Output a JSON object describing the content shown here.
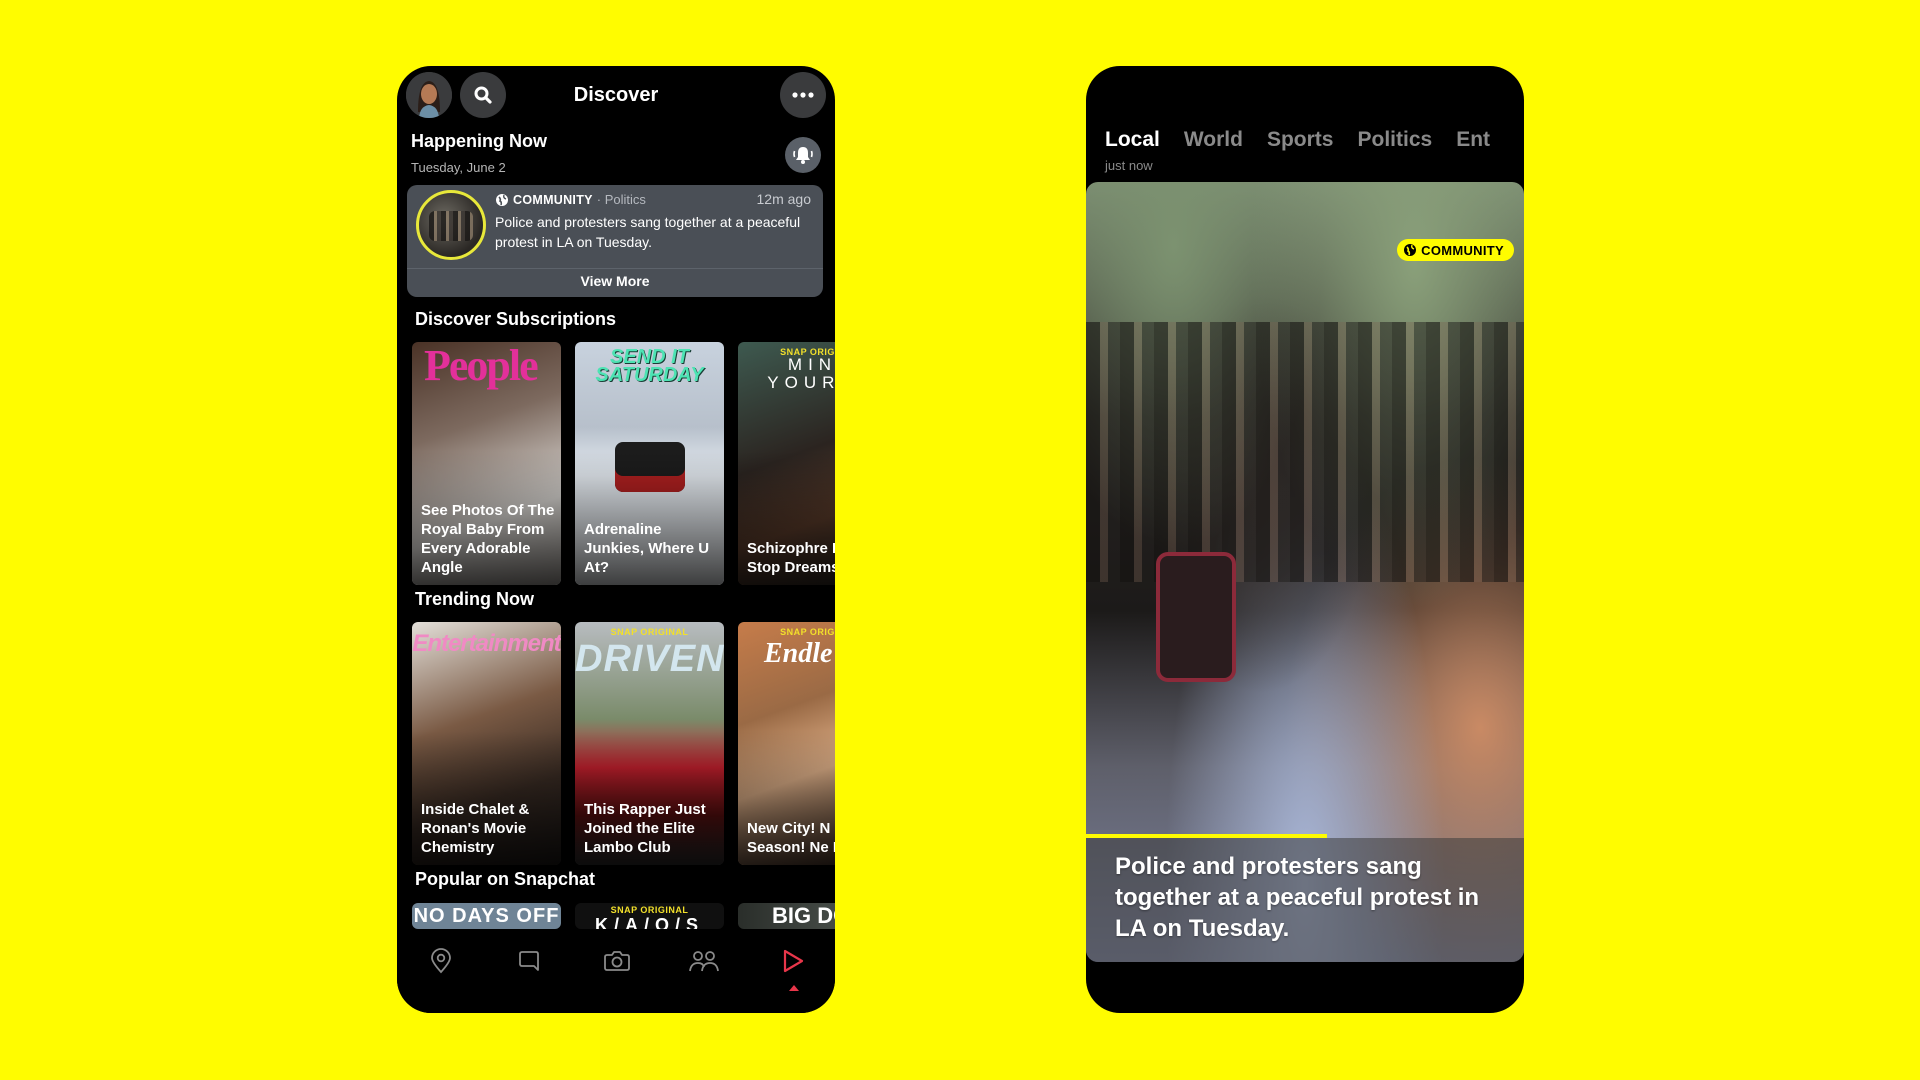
{
  "theme": {
    "background": "#FFFC00",
    "accent": "#FFFC00",
    "active_nav": "#E8364A",
    "card_bg": "#4A4F56"
  },
  "left_phone": {
    "header": {
      "avatar_icon": "bitmoji-avatar",
      "search_icon": "search-icon",
      "title": "Discover",
      "more_icon": "more-dots-icon"
    },
    "happening_now": {
      "title": "Happening Now",
      "date": "Tuesday, June 2",
      "notify_icon": "bell-ringing-icon",
      "story": {
        "source": "COMMUNITY",
        "category": "· Politics",
        "time": "12m ago",
        "headline": "Police and protesters sang together at a peaceful protest in LA on Tuesday.",
        "action": "View More"
      }
    },
    "sections": [
      {
        "title": "Discover Subscriptions",
        "tiles": [
          {
            "brand": "People",
            "snap_original": "",
            "caption": "See Photos Of The Royal Baby From Every Adorable Angle"
          },
          {
            "brand": "SEND IT SATURDAY",
            "snap_original": "",
            "caption": "Adrenaline Junkies, Where U At?"
          },
          {
            "brand": "MIN YOURS",
            "snap_original": "SNAP ORIGIN",
            "caption": "Schizophre Didn't Stop Dreams"
          }
        ]
      },
      {
        "title": "Trending Now",
        "tiles": [
          {
            "brand": "Entertainment",
            "snap_original": "",
            "caption": "Inside Chalet & Ronan's Movie Chemistry"
          },
          {
            "brand": "DRIVEN",
            "snap_original": "SNAP ORIGINAL",
            "caption": "This Rapper Just Joined the Elite Lambo Club"
          },
          {
            "brand": "Endle",
            "snap_original": "SNAP ORIGIN",
            "caption": "New City! N Season! Ne Dylan!"
          }
        ]
      },
      {
        "title": "Popular on Snapchat",
        "tiles": [
          {
            "brand": "NO DAYS OFF",
            "snap_original": ""
          },
          {
            "brand": "K/A/O/S",
            "snap_original": "SNAP ORIGINAL"
          },
          {
            "brand": "BIG DO",
            "snap_original": ""
          }
        ]
      }
    ],
    "bottom_nav": [
      {
        "name": "map",
        "icon": "map-pin-icon",
        "active": false
      },
      {
        "name": "chat",
        "icon": "chat-bubble-icon",
        "active": false
      },
      {
        "name": "camera",
        "icon": "camera-icon",
        "active": false
      },
      {
        "name": "stories",
        "icon": "friends-icon",
        "active": false
      },
      {
        "name": "discover",
        "icon": "play-triangle-icon",
        "active": true
      }
    ]
  },
  "right_phone": {
    "tabs": [
      {
        "label": "Local",
        "active": true
      },
      {
        "label": "World",
        "active": false
      },
      {
        "label": "Sports",
        "active": false
      },
      {
        "label": "Politics",
        "active": false
      },
      {
        "label": "Ent",
        "active": false
      }
    ],
    "active_tab_subtitle": "just now",
    "video": {
      "badge": "COMMUNITY",
      "badge_icon": "globe-icon",
      "progress_percent": 55,
      "caption": "Police and protesters sang together at a peaceful protest in LA on Tuesday."
    }
  }
}
